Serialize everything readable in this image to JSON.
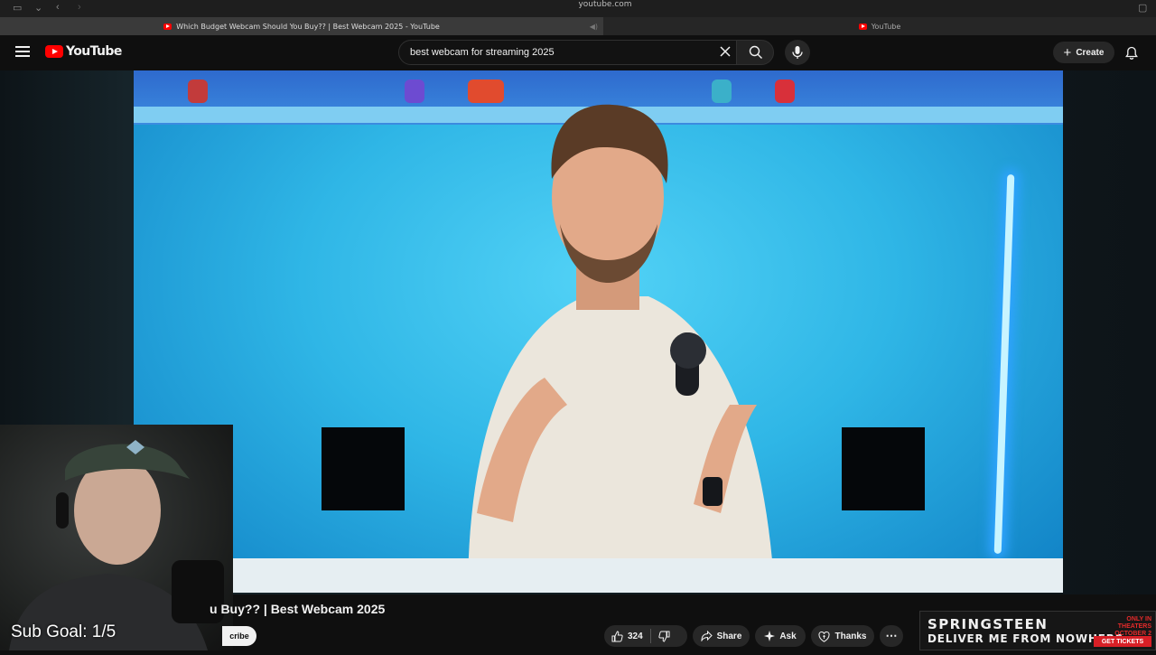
{
  "browser": {
    "url": "youtube.com",
    "tabs": [
      {
        "title": "Which Budget Webcam Should You Buy?? | Best Webcam 2025 - YouTube",
        "active": true
      },
      {
        "title": "YouTube",
        "active": false
      }
    ]
  },
  "header": {
    "logo_text": "YouTube",
    "search_value": "best webcam for streaming 2025",
    "create_label": "Create"
  },
  "video": {
    "title_partial": "u Buy?? | Best Webcam 2025"
  },
  "overlay": {
    "sub_goal": "Sub Goal: 1/5"
  },
  "channel": {
    "subscribe_partial": "cribe"
  },
  "actions": {
    "like_count": "324",
    "share_label": "Share",
    "ask_label": "Ask",
    "thanks_label": "Thanks"
  },
  "ad": {
    "line1": "SPRINGSTEEN",
    "line2": "DELIVER ME FROM NOWHERE",
    "promo": "ONLY IN THEATERS OCTOBER 2",
    "cta": "GET TICKETS"
  },
  "colors": {
    "brand_red": "#ff0000",
    "background": "#0f0f0f",
    "chip": "#272727"
  }
}
